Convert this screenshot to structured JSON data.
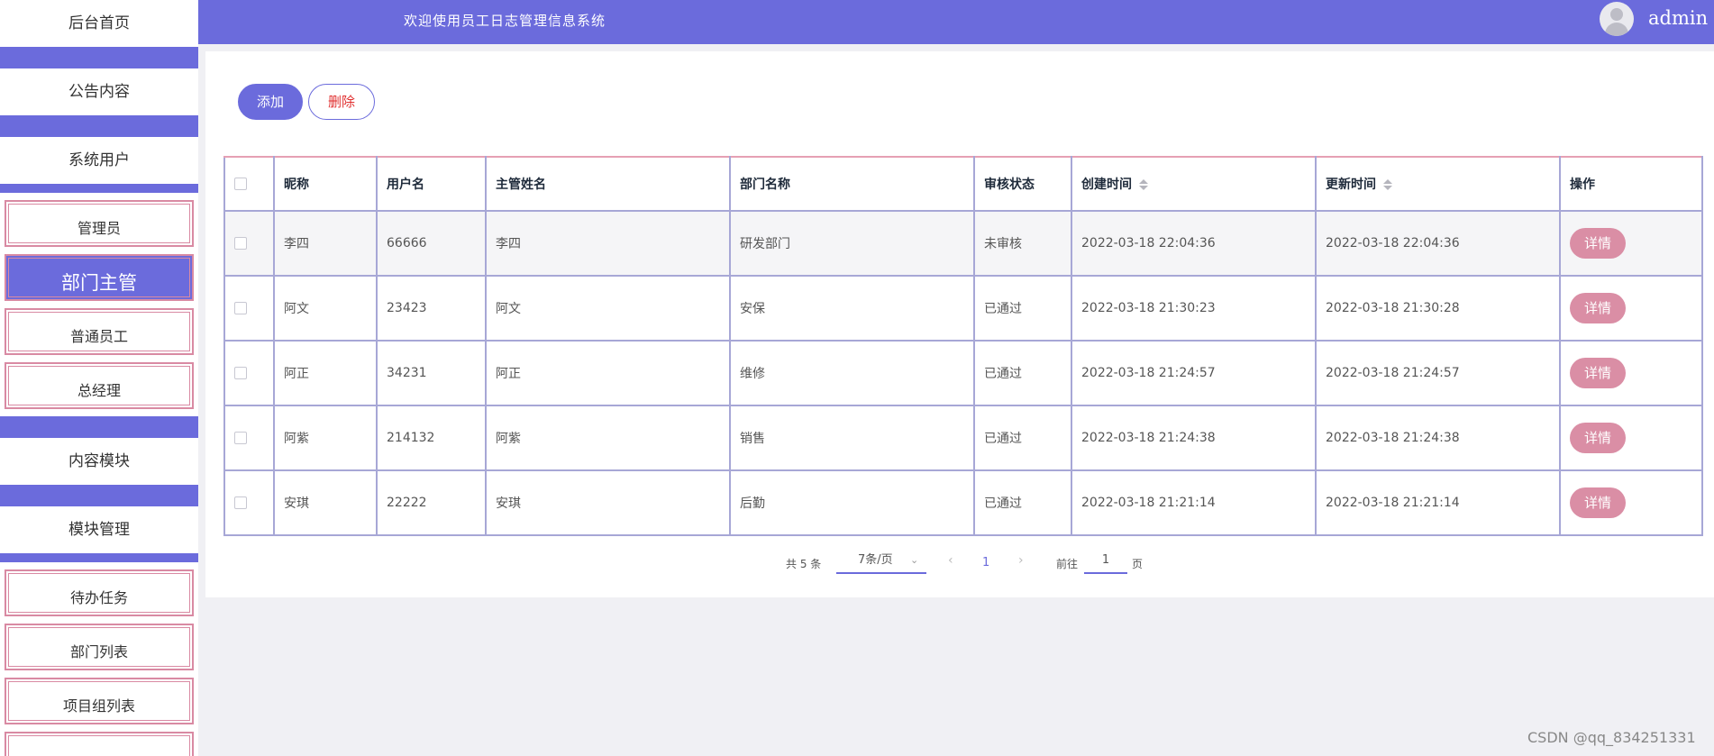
{
  "sidebar": {
    "home": "后台首页",
    "announcement": "公告内容",
    "system_users": "系统用户",
    "user_items": [
      "管理员",
      "部门主管",
      "普通员工",
      "总经理"
    ],
    "content_module": "内容模块",
    "module_manage": "模块管理",
    "module_items": [
      "待办任务",
      "部门列表",
      "项目组列表"
    ]
  },
  "header": {
    "welcome": "欢迎使用员工日志管理信息系统",
    "username": "admin"
  },
  "toolbar": {
    "add_label": "添加",
    "delete_label": "删除"
  },
  "table": {
    "columns": [
      "昵称",
      "用户名",
      "主管姓名",
      "部门名称",
      "审核状态",
      "创建时间",
      "更新时间",
      "操作"
    ],
    "rows": [
      {
        "nickname": "李四",
        "username": "66666",
        "manager": "李四",
        "dept": "研发部门",
        "status": "未审核",
        "created": "2022-03-18 22:04:36",
        "updated": "2022-03-18 22:04:36",
        "action": "详情"
      },
      {
        "nickname": "阿文",
        "username": "23423",
        "manager": "阿文",
        "dept": "安保",
        "status": "已通过",
        "created": "2022-03-18 21:30:23",
        "updated": "2022-03-18 21:30:28",
        "action": "详情"
      },
      {
        "nickname": "阿正",
        "username": "34231",
        "manager": "阿正",
        "dept": "维修",
        "status": "已通过",
        "created": "2022-03-18 21:24:57",
        "updated": "2022-03-18 21:24:57",
        "action": "详情"
      },
      {
        "nickname": "阿紫",
        "username": "214132",
        "manager": "阿紫",
        "dept": "销售",
        "status": "已通过",
        "created": "2022-03-18 21:24:38",
        "updated": "2022-03-18 21:24:38",
        "action": "详情"
      },
      {
        "nickname": "安琪",
        "username": "22222",
        "manager": "安琪",
        "dept": "后勤",
        "status": "已通过",
        "created": "2022-03-18 21:21:14",
        "updated": "2022-03-18 21:21:14",
        "action": "详情"
      }
    ]
  },
  "pagination": {
    "total": "共 5 条",
    "page_size": "7条/页",
    "current_page": "1",
    "goto_label": "前往",
    "goto_value": "1",
    "page_word": "页"
  },
  "watermark": "CSDN @qq_834251331",
  "colors": {
    "accent": "#6b6bdc",
    "detail_button": "#da8ea5",
    "delete_text": "#e03030"
  }
}
